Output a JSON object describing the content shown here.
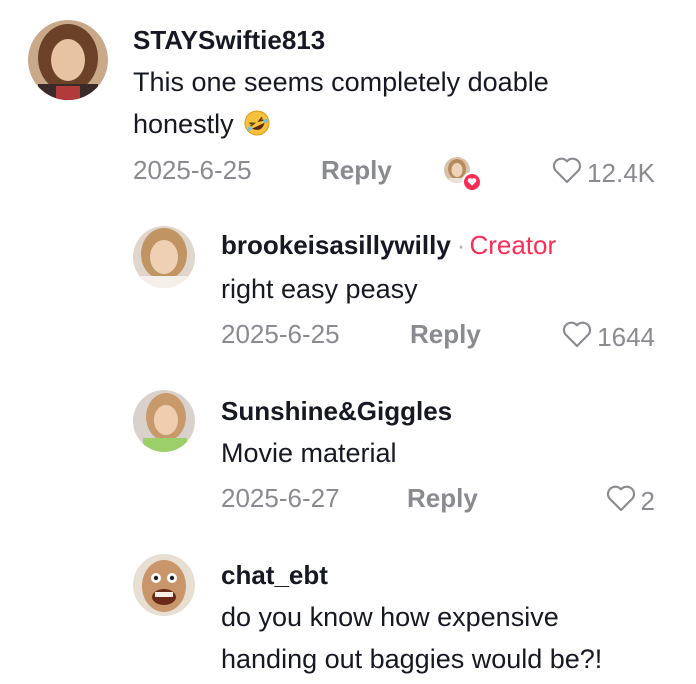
{
  "comments": [
    {
      "username": "STAYSwiftie813",
      "text_line1": "This one seems completely doable",
      "text_line2": "honestly",
      "emoji": "rofl-emoji",
      "date": "2025-6-25",
      "reply_label": "Reply",
      "likes": "12.4K",
      "liked_by_creator": true
    },
    {
      "username": "brookeisasillywilly",
      "creator_separator": "·",
      "creator_label": "Creator",
      "text": "right easy peasy",
      "date": "2025-6-25",
      "reply_label": "Reply",
      "likes": "1644"
    },
    {
      "username": "Sunshine&Giggles",
      "text": "Movie material",
      "date": "2025-6-27",
      "reply_label": "Reply",
      "likes": "2"
    },
    {
      "username": "chat_ebt",
      "text_line1": "do you know how expensive",
      "text_line2": "handing out baggies would be?!"
    }
  ],
  "colors": {
    "creator_accent": "#fe2c55",
    "meta_gray": "#8a8b91",
    "text_primary": "#161823"
  }
}
